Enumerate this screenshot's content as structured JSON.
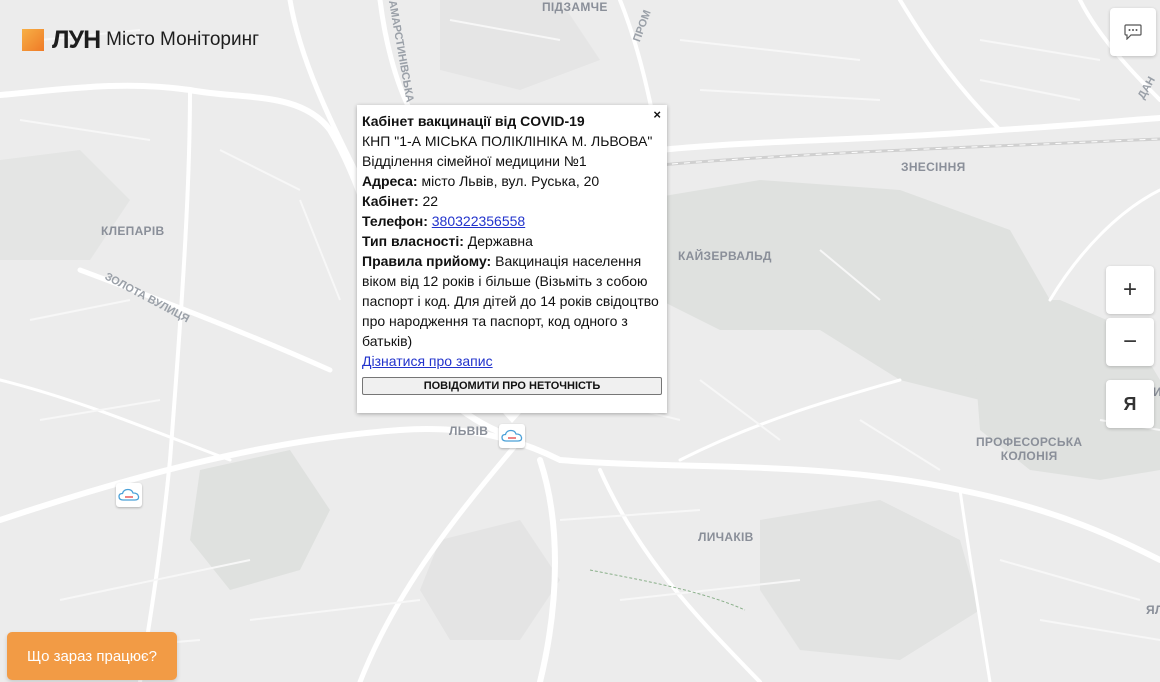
{
  "header": {
    "brand": "ЛУН",
    "title": "Місто Моніторинг"
  },
  "popup": {
    "title": "Кабінет вакцинації від COVID-19",
    "close": "×",
    "org": "КНП \"1-А МІСЬКА ПОЛІКЛІНІКА М. ЛЬВОВА\"",
    "department": "Відділення сімейної медицини №1",
    "address_label": "Адреса:",
    "address_value": "місто Львів, вул. Руська, 20",
    "cabinet_label": "Кабінет:",
    "cabinet_value": "22",
    "phone_label": "Телефон:",
    "phone_value": "380322356558",
    "ownership_label": "Тип власності:",
    "ownership_value": "Державна",
    "rules_label": "Правила прийому:",
    "rules_value": "Вакцинація населення віком від 12 років і більше (Візьміть з собою паспорт і код. Для дітей до 14 років свідоцтво про народження та паспорт, код одного з батьків)",
    "link": "Дізнатися про запис",
    "report_button": "ПОВІДОМИТИ ПРО НЕТОЧНІСТЬ"
  },
  "map": {
    "districts": {
      "pidzamche": "ПІДЗАМЧЕ",
      "znesinnia": "ЗНЕСІННЯ",
      "klepariv": "КЛЕПАРІВ",
      "kaizervald": "КАЙЗЕРВАЛЬД",
      "lviv": "ЛЬВІВ",
      "profesorska_line1": "ПРОФЕСОРСЬКА",
      "profesorska_line2": "КОЛОНІЯ",
      "lychakiv": "ЛИЧАКІВ"
    },
    "streets": {
      "zamarstynivska": "ЗАМАРСТИНІВСЬКА",
      "zolota": "ЗОЛОТА ВУЛИЦЯ",
      "promyslova": "ПРОМ"
    },
    "edge_labels": {
      "right_top": "ДАН",
      "right_mid": "И",
      "right_bottom": "ЯЛ"
    }
  },
  "controls": {
    "zoom_in": "+",
    "zoom_out": "−",
    "yandex": "Я"
  },
  "bottom": {
    "working_now": "Що зараз працює?"
  },
  "icons": {
    "chat": "chat-bubble-icon",
    "marker": "health-cloud-icon"
  },
  "colors": {
    "accent": "#f29b45",
    "map_bg": "#ececec",
    "road": "#ffffff",
    "park": "#dddfdd",
    "link": "#2233cc"
  }
}
